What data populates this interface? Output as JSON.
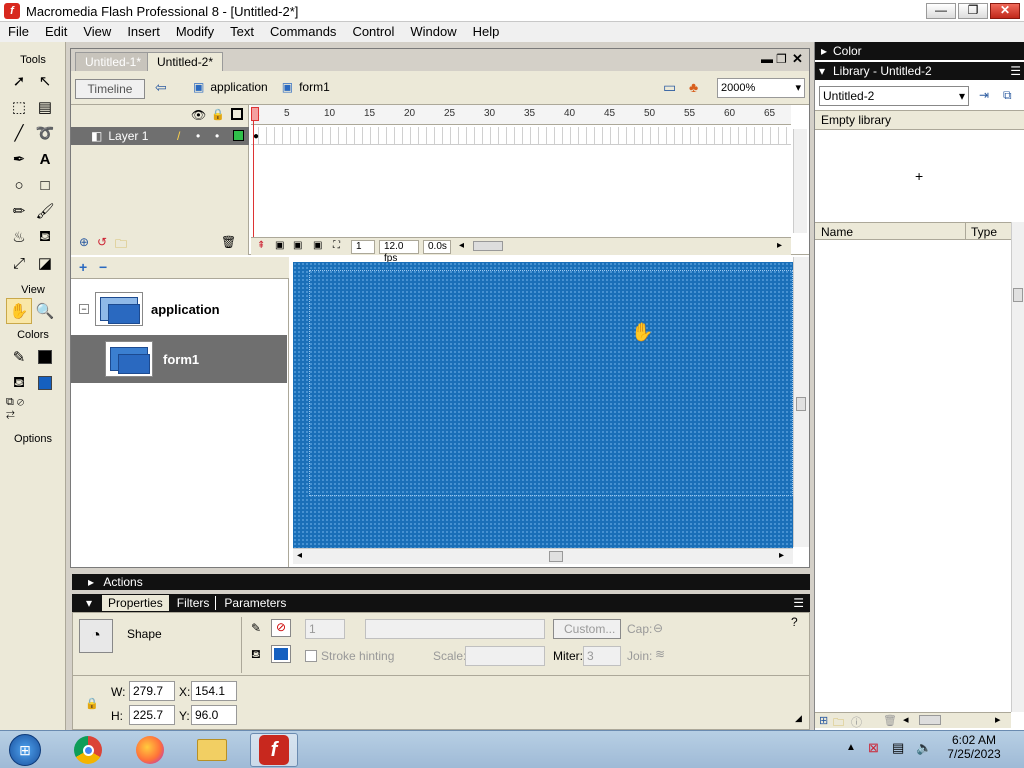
{
  "window": {
    "title": "Macromedia Flash Professional 8 - [Untitled-2*]",
    "app_icon": "flash-icon",
    "controls": {
      "minimize": "—",
      "restore": "❐",
      "close": "✕"
    }
  },
  "menu": [
    "File",
    "Edit",
    "View",
    "Insert",
    "Modify",
    "Text",
    "Commands",
    "Control",
    "Window",
    "Help"
  ],
  "tools": {
    "title": "Tools",
    "view_label": "View",
    "colors_label": "Colors",
    "options_label": "Options",
    "stroke_color": "#000000",
    "fill_color": "#1560c0"
  },
  "document": {
    "tabs": [
      "Untitled-1*",
      "Untitled-2*"
    ],
    "timeline_button": "Timeline",
    "breadcrumb": [
      "application",
      "form1"
    ],
    "zoom": "2000%"
  },
  "timeline": {
    "layer_name": "Layer 1",
    "ruler": [
      "1",
      "5",
      "10",
      "15",
      "20",
      "25",
      "30",
      "35",
      "40",
      "45",
      "50",
      "55",
      "60",
      "65"
    ],
    "current_frame": "1",
    "fps": "12.0 fps",
    "elapsed": "0.0s"
  },
  "screens": {
    "items": [
      {
        "label": "application",
        "selected": false
      },
      {
        "label": "form1",
        "selected": true
      }
    ]
  },
  "stage": {
    "color": "#1a6fb8"
  },
  "actions_panel": {
    "label": "Actions"
  },
  "properties": {
    "tabs": [
      "Properties",
      "Filters",
      "Parameters"
    ],
    "shape_label": "Shape",
    "stroke_width": "1",
    "custom_button": "Custom...",
    "cap_label": "Cap:",
    "stroke_hinting": "Stroke hinting",
    "scale_label": "Scale:",
    "miter_label": "Miter:",
    "miter_value": "3",
    "join_label": "Join:",
    "w_label": "W:",
    "w_value": "279.7",
    "x_label": "X:",
    "x_value": "154.1",
    "h_label": "H:",
    "h_value": "225.7",
    "y_label": "Y:",
    "y_value": "96.0"
  },
  "right_panels": {
    "color_label": "Color",
    "library_label": "Library - Untitled-2",
    "library_select": "Untitled-2",
    "empty_text": "Empty library",
    "col_name": "Name",
    "col_type": "Type"
  },
  "taskbar": {
    "time": "6:02 AM",
    "date": "7/25/2023"
  }
}
